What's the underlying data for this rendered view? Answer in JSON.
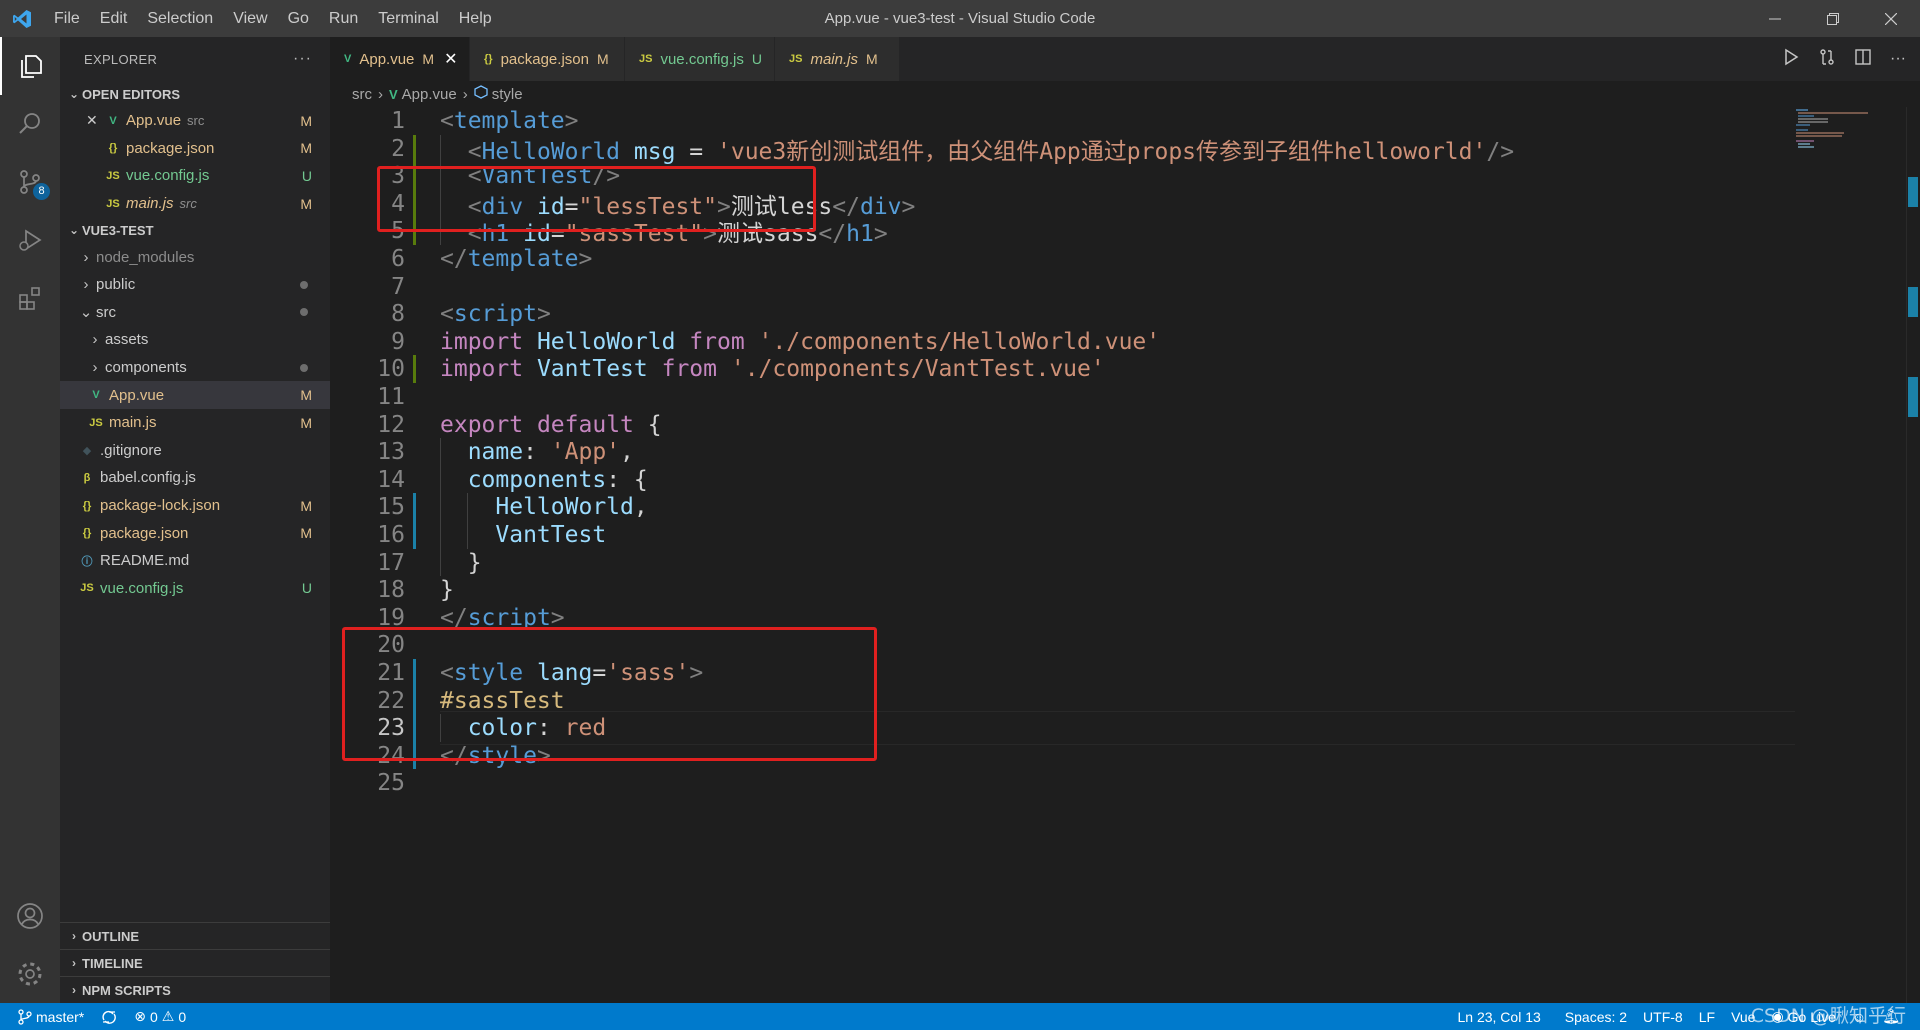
{
  "window": {
    "title": "App.vue - vue3-test - Visual Studio Code",
    "menu": [
      "File",
      "Edit",
      "Selection",
      "View",
      "Go",
      "Run",
      "Terminal",
      "Help"
    ]
  },
  "activity_bar": {
    "items": [
      "explorer-icon",
      "search-icon",
      "source-control-icon",
      "run-debug-icon",
      "extensions-icon"
    ],
    "scm_badge": "8",
    "bottom": [
      "account-icon",
      "manage-gear-icon"
    ]
  },
  "sidebar": {
    "header": "EXPLORER",
    "more": "···",
    "open_editors": {
      "title": "OPEN EDITORS",
      "items": [
        {
          "icon": "V",
          "name": "App.vue",
          "desc": "src",
          "status": "M",
          "icon_color": "#41b883",
          "name_color": "#e2c08d",
          "italic": false,
          "close": "✕"
        },
        {
          "icon": "{}",
          "name": "package.json",
          "desc": "",
          "status": "M",
          "icon_color": "#cbcb41",
          "name_color": "#e2c08d",
          "italic": false
        },
        {
          "icon": "JS",
          "name": "vue.config.js",
          "desc": "",
          "status": "U",
          "icon_color": "#cbcb41",
          "name_color": "#73c991",
          "italic": false
        },
        {
          "icon": "JS",
          "name": "main.js",
          "desc": "src",
          "status": "M",
          "icon_color": "#cbcb41",
          "name_color": "#e2c08d",
          "italic": true
        }
      ]
    },
    "project": {
      "title": "VUE3-TEST",
      "items": [
        {
          "chev": "›",
          "name": "node_modules",
          "color": "#8c8c8c",
          "depth": 0
        },
        {
          "chev": "›",
          "name": "public",
          "color": "#cccccc",
          "depth": 0,
          "dot": true
        },
        {
          "chev": "⌄",
          "name": "src",
          "color": "#cccccc",
          "depth": 0,
          "dot": true
        },
        {
          "chev": "›",
          "name": "assets",
          "color": "#cccccc",
          "depth": 1
        },
        {
          "chev": "›",
          "name": "components",
          "color": "#cccccc",
          "depth": 1,
          "dot": true
        },
        {
          "icon": "V",
          "icon_color": "#41b883",
          "name": "App.vue",
          "color": "#e2c08d",
          "depth": 1,
          "status": "M",
          "selected": true
        },
        {
          "icon": "JS",
          "icon_color": "#cbcb41",
          "name": "main.js",
          "color": "#e2c08d",
          "depth": 1,
          "status": "M"
        },
        {
          "icon": "◆",
          "icon_color": "#41535b",
          "name": ".gitignore",
          "color": "#cccccc",
          "depth": 0
        },
        {
          "icon": "β",
          "icon_color": "#cbcb41",
          "name": "babel.config.js",
          "color": "#cccccc",
          "depth": 0
        },
        {
          "icon": "{}",
          "icon_color": "#cbcb41",
          "name": "package-lock.json",
          "color": "#e2c08d",
          "depth": 0,
          "status": "M"
        },
        {
          "icon": "{}",
          "icon_color": "#cbcb41",
          "name": "package.json",
          "color": "#e2c08d",
          "depth": 0,
          "status": "M"
        },
        {
          "icon": "ⓘ",
          "icon_color": "#519aba",
          "name": "README.md",
          "color": "#cccccc",
          "depth": 0
        },
        {
          "icon": "JS",
          "icon_color": "#cbcb41",
          "name": "vue.config.js",
          "color": "#73c991",
          "depth": 0,
          "status": "U"
        }
      ]
    },
    "bottom_sections": [
      "OUTLINE",
      "TIMELINE",
      "NPM SCRIPTS"
    ]
  },
  "tabs": [
    {
      "icon": "V",
      "icon_color": "#41b883",
      "label": "App.vue",
      "status": "M",
      "active": true,
      "label_color": "#e2c08d",
      "close": "✕"
    },
    {
      "icon": "{}",
      "icon_color": "#cbcb41",
      "label": "package.json",
      "status": "M",
      "active": false,
      "label_color": "#e2c08d"
    },
    {
      "icon": "JS",
      "icon_color": "#cbcb41",
      "label": "vue.config.js",
      "status": "U",
      "active": false,
      "label_color": "#73c991"
    },
    {
      "icon": "JS",
      "icon_color": "#cbcb41",
      "label": "main.js",
      "status": "M",
      "active": false,
      "label_color": "#e2c08d",
      "italic": true
    }
  ],
  "breadcrumb": [
    "src",
    "App.vue",
    "style"
  ],
  "editor": {
    "current_line": 23,
    "lines": [
      [
        [
          "t-tag",
          "<"
        ],
        [
          "t-tname",
          "template"
        ],
        [
          "t-tag",
          ">"
        ]
      ],
      [
        [
          "t-plain",
          "  "
        ],
        [
          "t-tag",
          "<"
        ],
        [
          "t-tname",
          "HelloWorld"
        ],
        [
          "t-plain",
          " "
        ],
        [
          "t-attr",
          "msg"
        ],
        [
          "t-plain",
          " = "
        ],
        [
          "t-str",
          "'vue3新创测试组件，由父组件App通过props传参到子组件helloworld'"
        ],
        [
          "t-tag",
          "/>"
        ]
      ],
      [
        [
          "t-plain",
          "  "
        ],
        [
          "t-tag",
          "<"
        ],
        [
          "t-tname",
          "VantTest"
        ],
        [
          "t-tag",
          "/>"
        ]
      ],
      [
        [
          "t-plain",
          "  "
        ],
        [
          "t-tag",
          "<"
        ],
        [
          "t-tname",
          "div"
        ],
        [
          "t-plain",
          " "
        ],
        [
          "t-attr",
          "id"
        ],
        [
          "t-plain",
          "="
        ],
        [
          "t-str",
          "\"lessTest\""
        ],
        [
          "t-tag",
          ">"
        ],
        [
          "t-plain",
          "测试less"
        ],
        [
          "t-tag",
          "</"
        ],
        [
          "t-tname",
          "div"
        ],
        [
          "t-tag",
          ">"
        ]
      ],
      [
        [
          "t-plain",
          "  "
        ],
        [
          "t-tag",
          "<"
        ],
        [
          "t-tname",
          "h1"
        ],
        [
          "t-plain",
          " "
        ],
        [
          "t-attr",
          "id"
        ],
        [
          "t-plain",
          "="
        ],
        [
          "t-str",
          "\"sassTest\""
        ],
        [
          "t-tag",
          ">"
        ],
        [
          "t-plain",
          "测试sass"
        ],
        [
          "t-tag",
          "</"
        ],
        [
          "t-tname",
          "h1"
        ],
        [
          "t-tag",
          ">"
        ]
      ],
      [
        [
          "t-tag",
          "</"
        ],
        [
          "t-tname",
          "template"
        ],
        [
          "t-tag",
          ">"
        ]
      ],
      [],
      [
        [
          "t-tag",
          "<"
        ],
        [
          "t-tname",
          "script"
        ],
        [
          "t-tag",
          ">"
        ]
      ],
      [
        [
          "t-kw",
          "import"
        ],
        [
          "t-plain",
          " "
        ],
        [
          "t-id",
          "HelloWorld"
        ],
        [
          "t-plain",
          " "
        ],
        [
          "t-kw",
          "from"
        ],
        [
          "t-plain",
          " "
        ],
        [
          "t-str",
          "'./components/HelloWorld.vue'"
        ]
      ],
      [
        [
          "t-kw",
          "import"
        ],
        [
          "t-plain",
          " "
        ],
        [
          "t-id",
          "VantTest"
        ],
        [
          "t-plain",
          " "
        ],
        [
          "t-kw",
          "from"
        ],
        [
          "t-plain",
          " "
        ],
        [
          "t-str",
          "'./components/VantTest.vue'"
        ]
      ],
      [],
      [
        [
          "t-kw",
          "export"
        ],
        [
          "t-plain",
          " "
        ],
        [
          "t-kw",
          "default"
        ],
        [
          "t-plain",
          " {"
        ]
      ],
      [
        [
          "t-plain",
          "  "
        ],
        [
          "t-id",
          "name"
        ],
        [
          "t-plain",
          ": "
        ],
        [
          "t-str",
          "'App'"
        ],
        [
          "t-plain",
          ","
        ]
      ],
      [
        [
          "t-plain",
          "  "
        ],
        [
          "t-id",
          "components"
        ],
        [
          "t-plain",
          ": {"
        ]
      ],
      [
        [
          "t-plain",
          "    "
        ],
        [
          "t-id",
          "HelloWorld"
        ],
        [
          "t-plain",
          ","
        ]
      ],
      [
        [
          "t-plain",
          "    "
        ],
        [
          "t-id",
          "VantTest"
        ]
      ],
      [
        [
          "t-plain",
          "  }"
        ]
      ],
      [
        [
          "t-plain",
          "}"
        ]
      ],
      [
        [
          "t-tag",
          "</"
        ],
        [
          "t-tname",
          "script"
        ],
        [
          "t-tag",
          ">"
        ]
      ],
      [],
      [
        [
          "t-tag",
          "<"
        ],
        [
          "t-tname",
          "style"
        ],
        [
          "t-plain",
          " "
        ],
        [
          "t-attr",
          "lang"
        ],
        [
          "t-plain",
          "="
        ],
        [
          "t-str",
          "'sass'"
        ],
        [
          "t-tag",
          ">"
        ]
      ],
      [
        [
          "t-sel",
          "#sassTest"
        ]
      ],
      [
        [
          "t-plain",
          "  "
        ],
        [
          "t-attr",
          "color"
        ],
        [
          "t-plain",
          ": "
        ],
        [
          "t-str",
          "red"
        ]
      ],
      [
        [
          "t-tag",
          "</"
        ],
        [
          "t-tname",
          "style"
        ],
        [
          "t-tag",
          ">"
        ]
      ],
      []
    ]
  },
  "statusbar": {
    "branch": "master*",
    "sync_icon": "sync-icon",
    "errors": "0",
    "warnings": "0",
    "position": "Ln 23, Col 13",
    "spaces": "Spaces: 2",
    "encoding": "UTF-8",
    "eol": "LF",
    "language": "Vue",
    "golive": "Go Live",
    "watermark": "CSDN @瞅知乎行"
  }
}
